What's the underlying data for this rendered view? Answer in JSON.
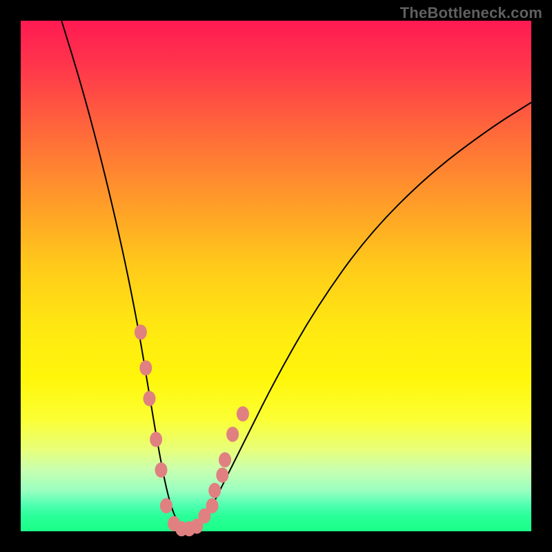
{
  "watermark": "TheBottleneck.com",
  "colors": {
    "frame": "#000000",
    "curve": "#000000",
    "dot": "#e08080",
    "gradient_top": "#ff1a52",
    "gradient_bottom": "#1aff88"
  },
  "chart_data": {
    "type": "line",
    "title": "",
    "xlabel": "",
    "ylabel": "",
    "xlim": [
      0,
      100
    ],
    "ylim": [
      0,
      100
    ],
    "curve": {
      "description": "Bottleneck V-curve: steep descent from top-left to a minimum near x≈30, then gradual rise toward top-right. Approximate (x,y) pairs, y=0 at bottom, y=100 at top.",
      "points": [
        [
          8,
          100
        ],
        [
          12,
          87
        ],
        [
          16,
          72
        ],
        [
          20,
          55
        ],
        [
          23,
          40
        ],
        [
          25,
          28
        ],
        [
          27,
          16
        ],
        [
          29,
          6
        ],
        [
          31,
          1
        ],
        [
          33,
          0
        ],
        [
          35,
          1
        ],
        [
          37,
          4
        ],
        [
          40,
          10
        ],
        [
          44,
          18
        ],
        [
          50,
          30
        ],
        [
          58,
          44
        ],
        [
          68,
          58
        ],
        [
          80,
          70
        ],
        [
          92,
          79
        ],
        [
          100,
          84
        ]
      ]
    },
    "dots": {
      "description": "Highlighted sample points (pink/coral dots) clustered along the lower portion of the V on both sides.",
      "points": [
        [
          23.5,
          39
        ],
        [
          24.5,
          32
        ],
        [
          25.2,
          26
        ],
        [
          26.5,
          18
        ],
        [
          27.5,
          12
        ],
        [
          28.5,
          5
        ],
        [
          30,
          1.5
        ],
        [
          31.5,
          0.5
        ],
        [
          33,
          0.5
        ],
        [
          34.5,
          1
        ],
        [
          36,
          3
        ],
        [
          37.5,
          5
        ],
        [
          38,
          8
        ],
        [
          39.5,
          11
        ],
        [
          40,
          14
        ],
        [
          41.5,
          19
        ],
        [
          43.5,
          23
        ]
      ]
    }
  }
}
